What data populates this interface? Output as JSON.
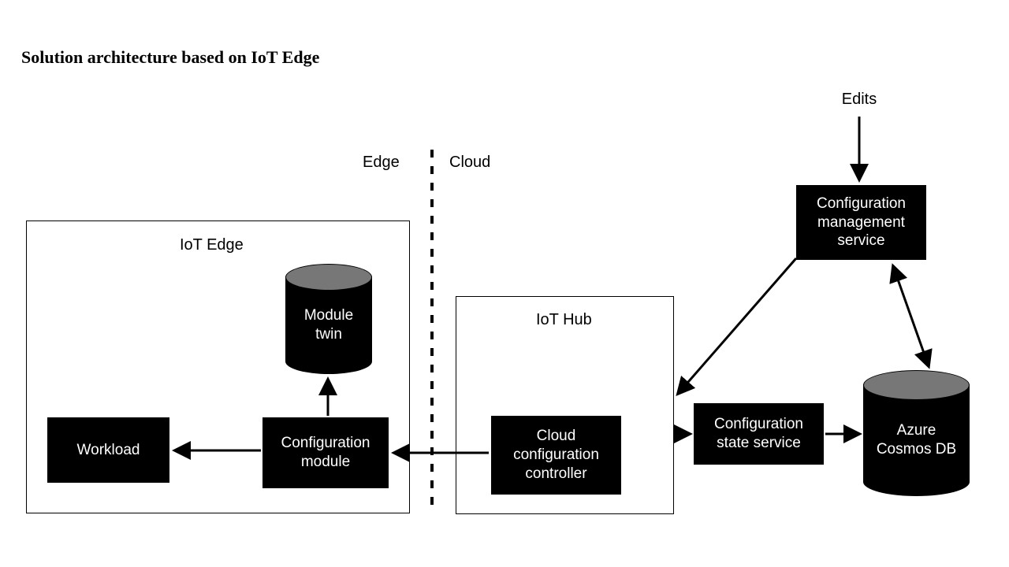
{
  "title": "Solution architecture based on IoT Edge",
  "labels": {
    "edge": "Edge",
    "cloud": "Cloud",
    "edits": "Edits",
    "iot_edge": "IoT Edge",
    "iot_hub": "IoT Hub"
  },
  "nodes": {
    "workload": "Workload",
    "config_module": "Configuration module",
    "module_twin": "Module twin",
    "cloud_controller": "Cloud configuration controller",
    "config_state_service": "Configuration state service",
    "config_mgmt_service": "Configuration management service",
    "cosmos_db": "Azure Cosmos DB"
  },
  "edges": [
    {
      "from": "edits_label",
      "to": "config_mgmt_service",
      "dir": "one"
    },
    {
      "from": "config_mgmt_service",
      "to": "iot_hub",
      "dir": "one"
    },
    {
      "from": "config_mgmt_service",
      "to": "cosmos_db",
      "dir": "both"
    },
    {
      "from": "iot_hub",
      "to": "config_state_service",
      "dir": "one"
    },
    {
      "from": "config_state_service",
      "to": "cosmos_db",
      "dir": "one"
    },
    {
      "from": "cloud_controller",
      "to": "config_module",
      "dir": "one"
    },
    {
      "from": "config_module",
      "to": "module_twin",
      "dir": "one"
    },
    {
      "from": "config_module",
      "to": "workload",
      "dir": "one"
    }
  ],
  "boundary": {
    "name": "edge_cloud_divider",
    "style": "dashed"
  }
}
